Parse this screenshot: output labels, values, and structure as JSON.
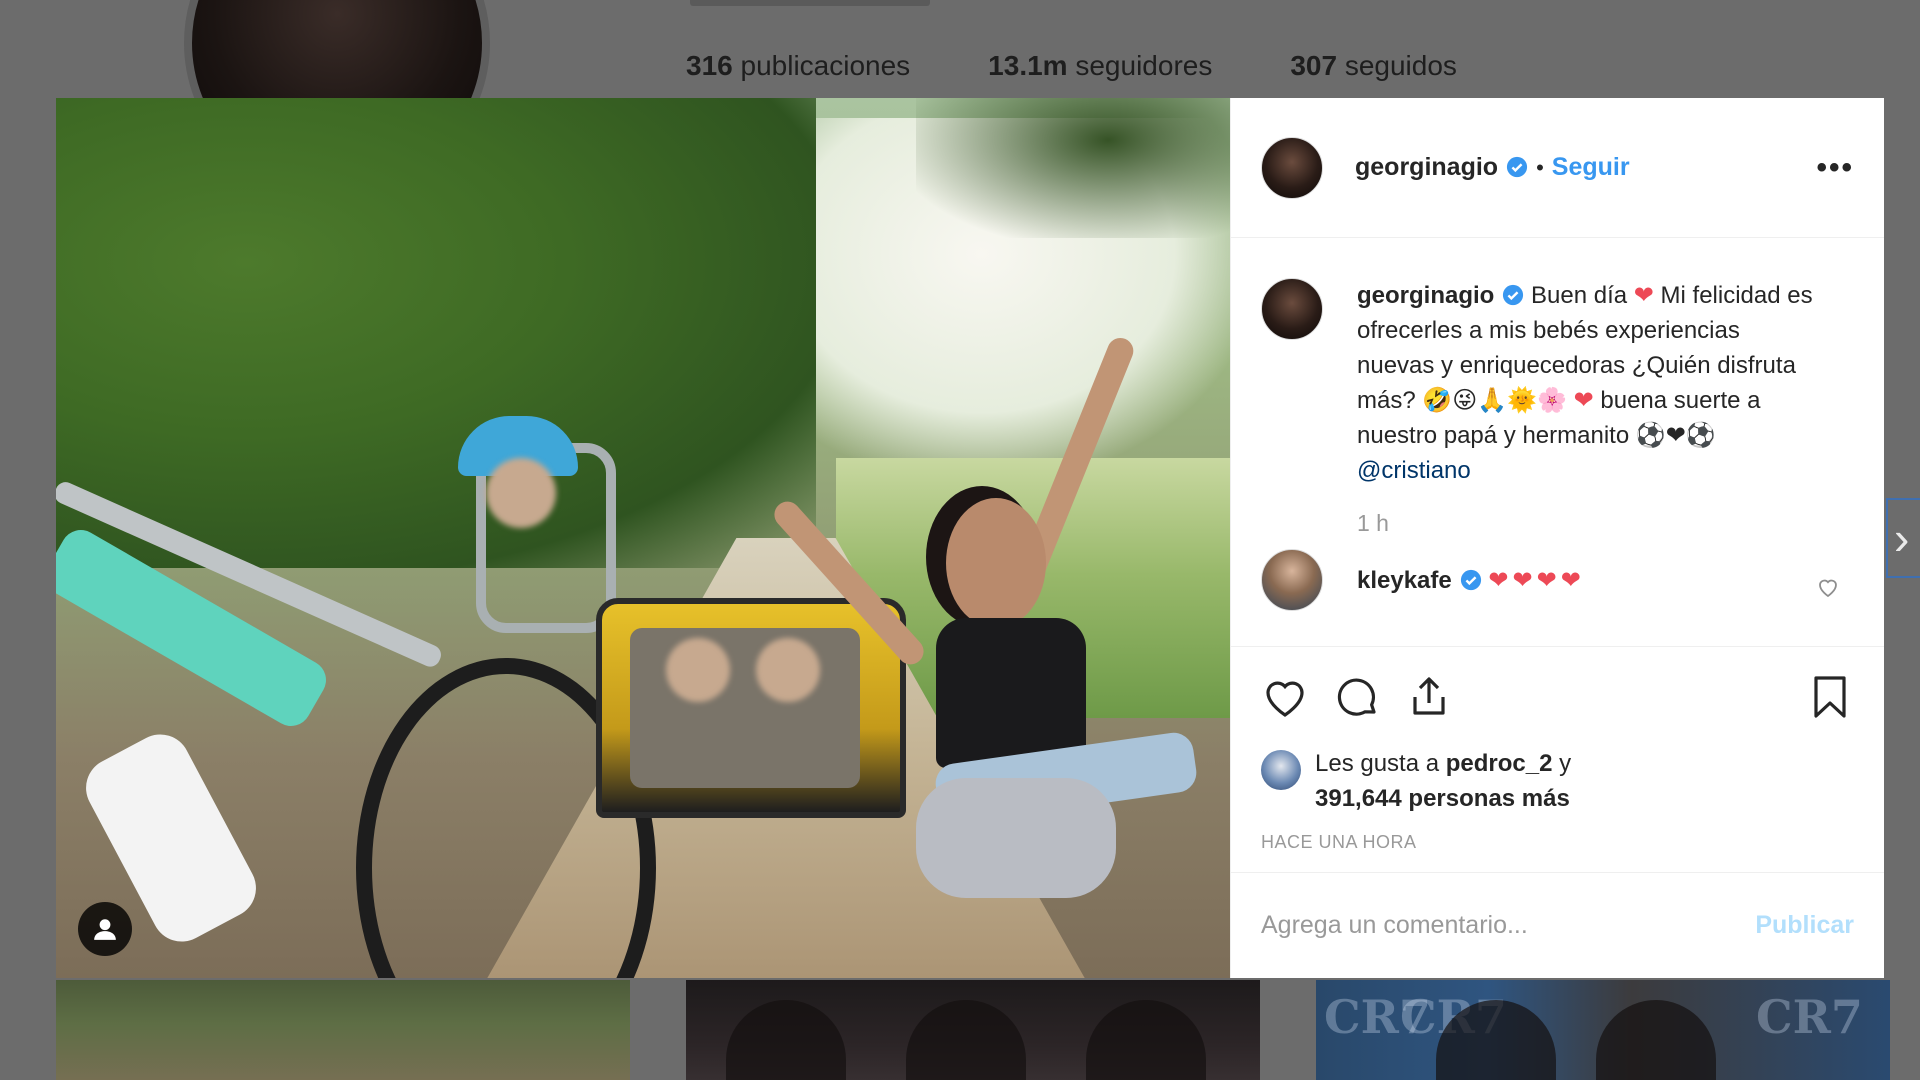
{
  "profile": {
    "stats": [
      {
        "value": "316",
        "label": "publicaciones"
      },
      {
        "value": "13.1m",
        "label": "seguidores"
      },
      {
        "value": "307",
        "label": "seguidos"
      }
    ]
  },
  "post": {
    "author": "georginagio",
    "follow_label": "Seguir",
    "more_label": "•••",
    "separator": "•",
    "caption": {
      "user": "georginagio",
      "text_1": "Buen día ",
      "emoji_1": "❤",
      "text_2": " Mi felicidad es ofrecerles a mis bebés experiencias nuevas y enriquecedoras ¿Quién disfruta más? ",
      "emoji_2": "🤣😜🙏🌞🌸",
      "emoji_3": "❤",
      "text_3": " buena suerte a nuestro papá y hermanito ",
      "emoji_4": "⚽❤⚽",
      "mention": "@cristiano"
    },
    "time": "1 h",
    "reply": {
      "user": "kleykafe",
      "text": "❤❤❤❤"
    },
    "likes": {
      "prefix": "Les gusta a ",
      "user": "pedroc_2",
      "suffix": " y",
      "others": "391,644 personas más"
    },
    "timestamp": "HACE UNA HORA",
    "comment_input": {
      "placeholder": "Agrega un comentario..."
    },
    "publish_label": "Publicar"
  },
  "background_tiles": {
    "cr7_text": "CR7"
  },
  "colors": {
    "accent": "#3897f0",
    "verified": "#3897f0",
    "heart": "#ed4956",
    "publish_disabled": "#b2dffc"
  },
  "icons": [
    "user-tag-icon",
    "heart-icon",
    "comment-icon",
    "share-icon",
    "bookmark-icon",
    "verified-icon",
    "chevron-right-icon"
  ]
}
